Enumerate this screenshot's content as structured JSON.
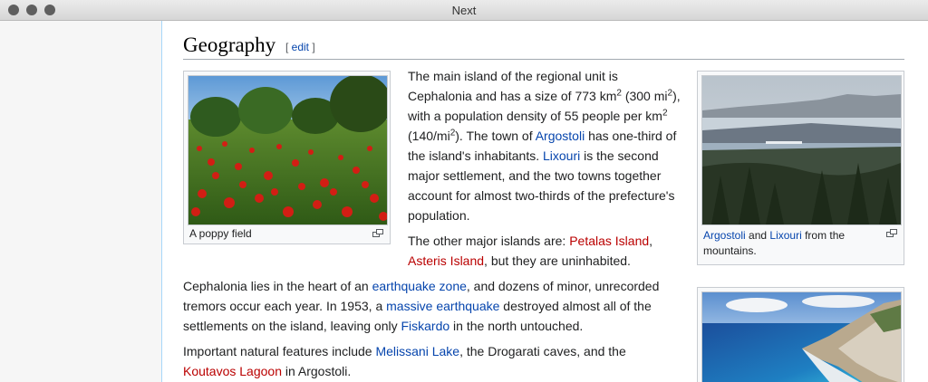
{
  "window": {
    "title": "Next"
  },
  "section": {
    "heading": "Geography",
    "edit_open": "[ ",
    "edit_label": "edit",
    "edit_close": " ]"
  },
  "figures": {
    "poppy": {
      "caption": "A poppy field"
    },
    "argostoli": {
      "caption_link1": "Argostoli",
      "caption_mid": " and ",
      "caption_link2": "Lixouri",
      "caption_end": " from the mountains."
    }
  },
  "paragraphs": {
    "p1": {
      "t1": "The main island of the regional unit is Cephalonia and has a size of 773 km",
      "sup1": "2",
      "t2": " (300 mi",
      "sup2": "2",
      "t3": "), with a population density of 55 people per km",
      "sup3": "2",
      "t4": " (140/mi",
      "sup4": "2",
      "t5": "). The town of ",
      "link_argostoli": "Argostoli",
      "t6": " has one-third of the island's inhabitants. ",
      "link_lixouri": "Lixouri",
      "t7": " is the second major settlement, and the two towns together account for almost two-thirds of the prefecture's population."
    },
    "p2": {
      "t1": "The other major islands are: ",
      "link_petalas": "Petalas Island",
      "t2": ", ",
      "link_asteris": "Asteris Island",
      "t3": ", but they are uninhabited."
    },
    "p3": {
      "t1": "Cephalonia lies in the heart of an ",
      "link_quake_zone": "earthquake zone",
      "t2": ", and dozens of minor, unrecorded tremors occur each year. In 1953, a ",
      "link_massive": "massive earthquake",
      "t3": " destroyed almost all of the settlements on the island, leaving only ",
      "link_fiskardo": "Fiskardo",
      "t4": " in the north untouched."
    },
    "p4": {
      "t1": "Important natural features include ",
      "link_melissani": "Melissani Lake",
      "t2": ", the Drogarati caves, and the ",
      "link_koutavos": "Koutavos Lagoon",
      "t3": " in Argostoli."
    }
  },
  "colors": {
    "link": "#0645ad",
    "redlink": "#ba0000",
    "text": "#202122"
  }
}
